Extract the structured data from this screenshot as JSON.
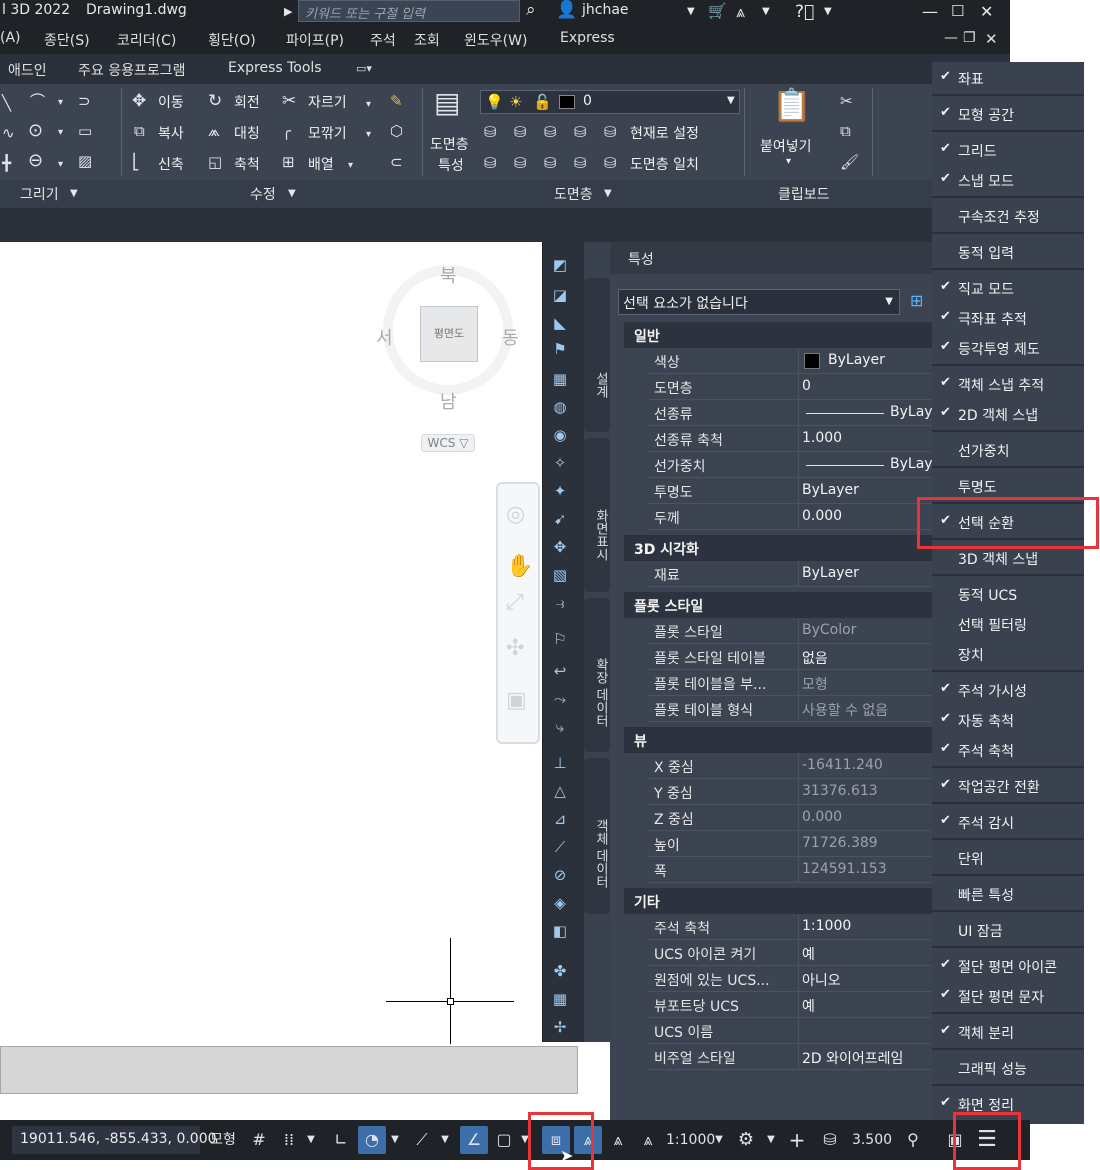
{
  "titlebar": {
    "app_title": "l 3D 2022",
    "file": "Drawing1.dwg",
    "search_placeholder": "키워드 또는 구절 입력",
    "user": "jhchae"
  },
  "menubar": [
    "(A)",
    "종단(S)",
    "코리더(C)",
    "횡단(O)",
    "파이프(P)",
    "주석",
    "조회",
    "윈도우(W)",
    "Express"
  ],
  "ribbon_tabs": [
    "애드인",
    "주요 응용프로그램",
    "Express Tools"
  ],
  "ribbon": {
    "modify": {
      "move": "이동",
      "rotate": "회전",
      "trim": "자르기",
      "copy": "복사",
      "mirror": "대칭",
      "fillet": "모깎기",
      "stretch": "신축",
      "scale": "축척",
      "array": "배열"
    },
    "layer": {
      "layer_props": "도면층\n특성",
      "layer_props_line1": "도면층",
      "layer_props_line2": "특성",
      "current_layer": "0",
      "set_current": "현재로 설정",
      "match_layer": "도면층 일치"
    },
    "clipboard": {
      "paste_line1": "붙여넣기"
    },
    "panels": [
      "그리기",
      "수정",
      "도면층",
      "클립보드"
    ]
  },
  "viewcube": {
    "north": "북",
    "south": "남",
    "east": "동",
    "west": "서",
    "face": "평면도",
    "wcs": "WCS"
  },
  "side_tabs": [
    "설계",
    "화면표시",
    "확장 데이터",
    "객체 데이터"
  ],
  "properties": {
    "title": "특성",
    "selection": "선택 요소가 없습니다",
    "sections": [
      {
        "name": "일반",
        "rows": [
          {
            "k": "색상",
            "v": "ByLayer"
          },
          {
            "k": "도면층",
            "v": "0"
          },
          {
            "k": "선종류",
            "v": "ByLaye"
          },
          {
            "k": "선종류 축척",
            "v": "1.000"
          },
          {
            "k": "선가중치",
            "v": "ByLaye"
          },
          {
            "k": "투명도",
            "v": "ByLayer"
          },
          {
            "k": "두께",
            "v": "0.000"
          }
        ]
      },
      {
        "name": "3D 시각화",
        "rows": [
          {
            "k": "재료",
            "v": "ByLayer"
          }
        ]
      },
      {
        "name": "플롯 스타일",
        "rows": [
          {
            "k": "플롯 스타일",
            "v": "ByColor"
          },
          {
            "k": "플롯 스타일 테이블",
            "v": "없음"
          },
          {
            "k": "플롯 테이블을 부...",
            "v": "모형"
          },
          {
            "k": "플롯 테이블 형식",
            "v": "사용할 수 없음"
          }
        ]
      },
      {
        "name": "뷰",
        "rows": [
          {
            "k": "X 중심",
            "v": "-16411.240"
          },
          {
            "k": "Y 중심",
            "v": "31376.613"
          },
          {
            "k": "Z 중심",
            "v": "0.000"
          },
          {
            "k": "높이",
            "v": "71726.389"
          },
          {
            "k": "폭",
            "v": "124591.153"
          }
        ]
      },
      {
        "name": "기타",
        "rows": [
          {
            "k": "주석 축척",
            "v": "1:1000"
          },
          {
            "k": "UCS 아이콘 켜기",
            "v": "예"
          },
          {
            "k": "원점에 있는 UCS...",
            "v": "아니오"
          },
          {
            "k": "뷰포트당 UCS",
            "v": "예"
          },
          {
            "k": "UCS 이름",
            "v": ""
          },
          {
            "k": "비주얼 스타일",
            "v": "2D 와이어프레임"
          }
        ]
      }
    ]
  },
  "status_menu": [
    {
      "label": "좌표",
      "checked": true
    },
    {
      "label": "모형 공간",
      "checked": true
    },
    {
      "label": "그리드",
      "checked": true
    },
    {
      "label": "스냅 모드",
      "checked": true
    },
    {
      "label": "구속조건 추정",
      "checked": false
    },
    {
      "label": "동적 입력",
      "checked": false
    },
    {
      "label": "직교 모드",
      "checked": true
    },
    {
      "label": "극좌표 추적",
      "checked": true
    },
    {
      "label": "등각투영 제도",
      "checked": true
    },
    {
      "label": "객체 스냅 추적",
      "checked": true
    },
    {
      "label": "2D 객체 스냅",
      "checked": true
    },
    {
      "label": "선가중치",
      "checked": false
    },
    {
      "label": "투명도",
      "checked": false
    },
    {
      "label": "선택 순환",
      "checked": true
    },
    {
      "label": "3D 객체 스냅",
      "checked": false
    },
    {
      "label": "동적 UCS",
      "checked": false
    },
    {
      "label": "선택 필터링",
      "checked": false
    },
    {
      "label": "장치",
      "checked": false
    },
    {
      "label": "주석 가시성",
      "checked": true
    },
    {
      "label": "자동 축척",
      "checked": true
    },
    {
      "label": "주석 축척",
      "checked": true
    },
    {
      "label": "작업공간 전환",
      "checked": true
    },
    {
      "label": "주석 감시",
      "checked": true
    },
    {
      "label": "단위",
      "checked": false
    },
    {
      "label": "빠른 특성",
      "checked": false
    },
    {
      "label": "UI 잠금",
      "checked": false
    },
    {
      "label": "절단 평면 아이콘",
      "checked": true
    },
    {
      "label": "절단 평면 문자",
      "checked": true
    },
    {
      "label": "객체 분리",
      "checked": true
    },
    {
      "label": "그래픽 성능",
      "checked": false
    },
    {
      "label": "화면 정리",
      "checked": true
    }
  ],
  "statusbar": {
    "coords": "19011.546, -855.433, 0.000",
    "model": "모형",
    "scale": "1:1000",
    "lineweight": "3.500"
  },
  "colors": {
    "highlight": "#e8353a",
    "accent": "#3c6faa",
    "panel": "#3c4452"
  }
}
